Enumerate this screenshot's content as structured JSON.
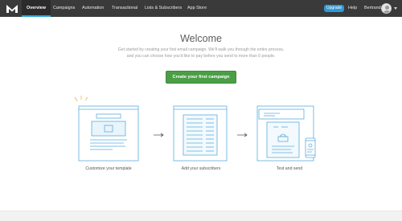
{
  "nav": {
    "items": [
      {
        "label": "Overview"
      },
      {
        "label": "Campaigns"
      },
      {
        "label": "Automation"
      },
      {
        "label": "Transactional"
      },
      {
        "label": "Lists & Subscribers"
      },
      {
        "label": "App Store"
      }
    ],
    "upgrade_label": "Upgrade",
    "help_label": "Help",
    "user_name": "Bertrand"
  },
  "main": {
    "title": "Welcome",
    "intro_line1": "Get started by creating your first email campaign. We'll walk you through the entire process,",
    "intro_line2": "and you can choose how you'd like to pay before you send to more than 0 people.",
    "cta_label": "Create your first campaign"
  },
  "steps": [
    {
      "label": "Customize your template"
    },
    {
      "label": "Add your subscribers"
    },
    {
      "label": "Test and send"
    }
  ],
  "colors": {
    "topbar": "#3a3a3a",
    "accent": "#29a5d8",
    "cta": "#4b9e45",
    "illustration_stroke": "#5aaedf"
  }
}
